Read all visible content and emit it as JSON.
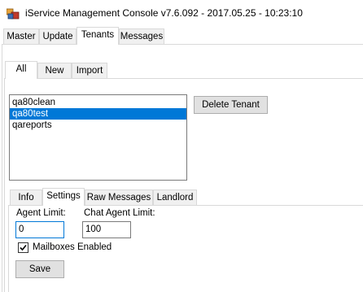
{
  "window": {
    "title": "iService Management Console v7.6.092 - 2017.05.25 - 10:23:10",
    "app_icon": "iservice-app-icon"
  },
  "main_tabs": [
    {
      "label": "Master"
    },
    {
      "label": "Update"
    },
    {
      "label": "Tenants",
      "active": true
    },
    {
      "label": "Messages"
    }
  ],
  "tenant_tabs": [
    {
      "label": "All",
      "active": true
    },
    {
      "label": "New"
    },
    {
      "label": "Import"
    }
  ],
  "tenant_list": {
    "items": [
      {
        "label": "qa80clean"
      },
      {
        "label": "qa80test",
        "selected": true
      },
      {
        "label": "qareports"
      }
    ]
  },
  "delete_tenant_button": "Delete Tenant",
  "detail_tabs": [
    {
      "label": "Info"
    },
    {
      "label": "Settings",
      "active": true
    },
    {
      "label": "Raw Messages"
    },
    {
      "label": "Landlord"
    }
  ],
  "settings": {
    "agent_limit_label": "Agent Limit:",
    "agent_limit_value": "0",
    "chat_agent_limit_label": "Chat Agent Limit:",
    "chat_agent_limit_value": "100",
    "mailboxes_enabled_label": "Mailboxes Enabled",
    "mailboxes_enabled": true,
    "save_label": "Save"
  },
  "colors": {
    "selection": "#0078d7",
    "tab_inactive": "#f0f0f0",
    "button_face": "#e1e1e1"
  }
}
